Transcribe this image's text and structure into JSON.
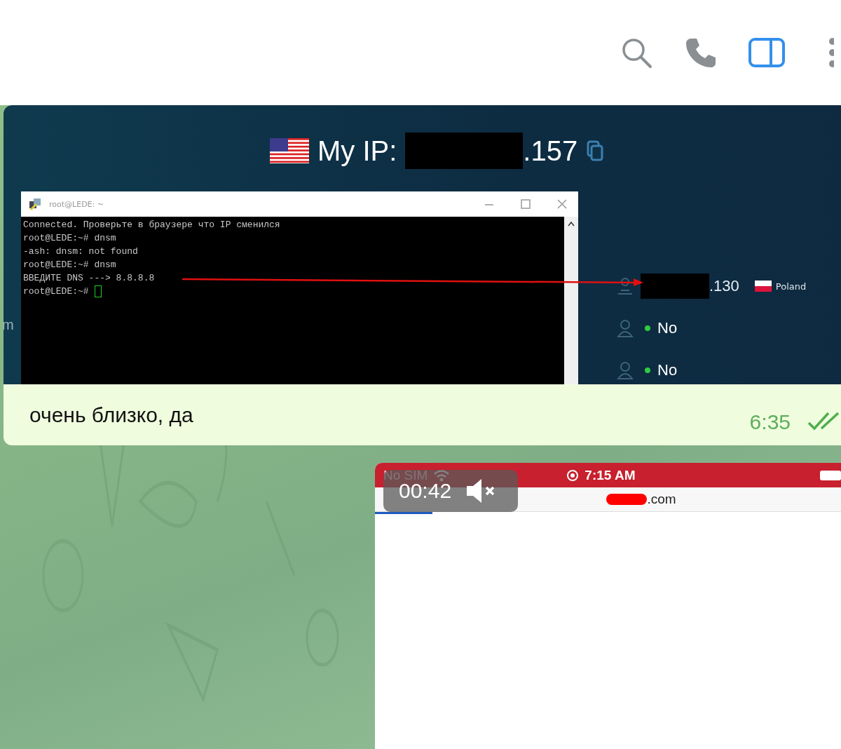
{
  "partial_text": "m",
  "message": {
    "my_ip_label": "My IP:",
    "my_ip_suffix": ".157",
    "terminal": {
      "title": "root@LEDE: ~",
      "lines": [
        {
          "kind": "text",
          "text": "Connected. Проверьте в браузере что IP сменился"
        },
        {
          "kind": "text",
          "text": "root@LEDE:~# dnsm"
        },
        {
          "kind": "text",
          "text": "-ash: dnsm: not found"
        },
        {
          "kind": "text",
          "text": "root@LEDE:~# dnsm"
        },
        {
          "kind": "arrow",
          "text": "ВВЕДИТЕ DNS ---> 8.8.8.8"
        },
        {
          "kind": "prompt",
          "text": "root@LEDE:~#"
        }
      ]
    },
    "info_rows": [
      {
        "kind": "ip",
        "value": ".130",
        "country": "Poland"
      },
      {
        "kind": "status",
        "value": "No",
        "color": "#2ecc40"
      },
      {
        "kind": "status",
        "value": "No",
        "color": "#2ecc40"
      }
    ],
    "caption": "очень близко, да",
    "time": "6:35",
    "read": true
  },
  "video": {
    "carrier": "No SIM",
    "clock": "7:15 AM",
    "url": ".com",
    "duration": "00:42",
    "muted": true,
    "level": 0.12
  }
}
